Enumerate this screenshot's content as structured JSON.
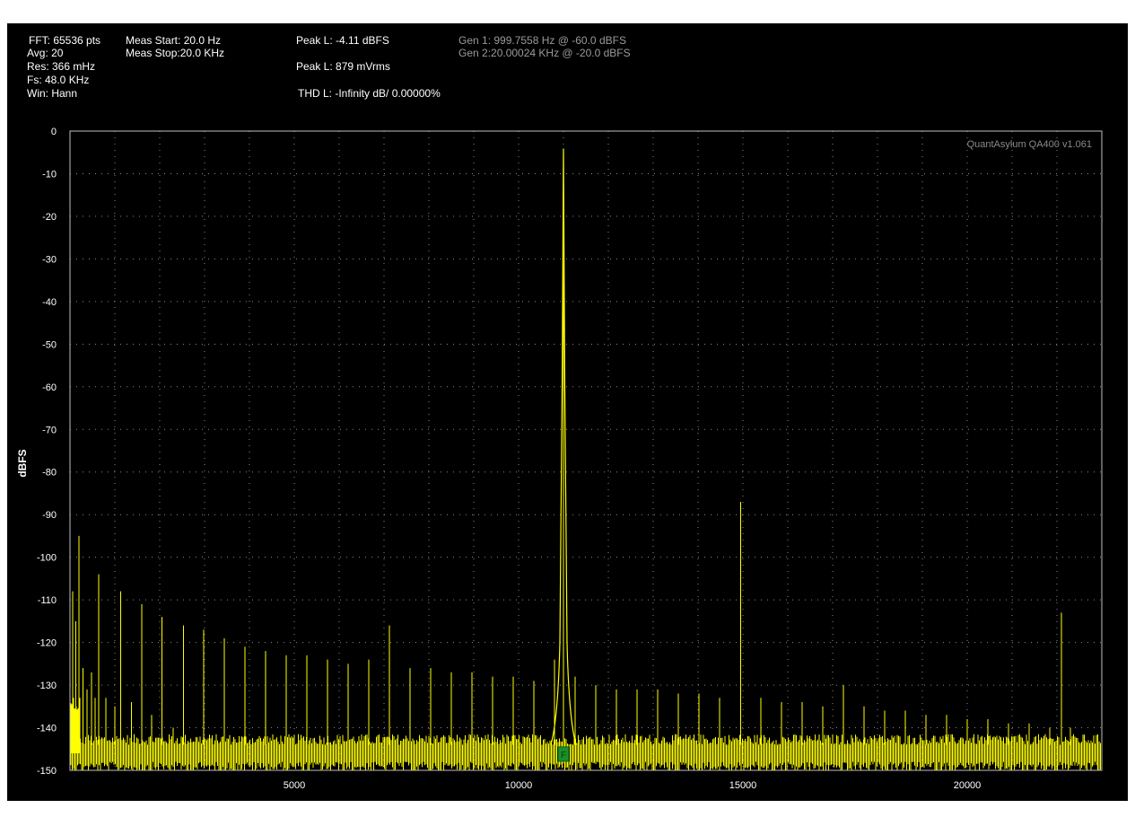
{
  "header": {
    "col1": [
      "FFT: 65536 pts",
      "Avg: 20",
      "Res: 366 mHz",
      "Fs: 48.0 KHz",
      "Win: Hann"
    ],
    "col2": [
      "Meas Start: 20.0 Hz",
      "Meas Stop:20.0 KHz"
    ],
    "peak_db": "Peak L: -4.11 dBFS",
    "peak_v": "Peak L: 879 mVrms",
    "thd": "THD L: -Infinity dB/ 0.00000%",
    "gen1": "Gen 1: 999.7558 Hz @ -60.0  dBFS",
    "gen2": "Gen 2:20.00024 KHz @ -20.0  dBFS"
  },
  "colors": {
    "background": "#000000",
    "trace": "#ffff00",
    "grid": "#8a8a8a",
    "marker": "#1a8f2a"
  },
  "chart_data": {
    "type": "line",
    "title": "",
    "brand_label": "QuantAsylum QA400 v1.061",
    "xlabel": "",
    "ylabel": "dBFS",
    "xlim": [
      0,
      23000
    ],
    "ylim": [
      -150,
      0
    ],
    "x_ticks": [
      5000,
      10000,
      15000,
      20000
    ],
    "x_tick_labels": [
      "5000",
      "10000",
      "15000",
      "20000"
    ],
    "y_ticks": [
      0,
      -10,
      -20,
      -30,
      -40,
      -50,
      -60,
      -70,
      -80,
      -90,
      -100,
      -110,
      -120,
      -130,
      -140,
      -150
    ],
    "y_tick_labels": [
      "0",
      "-10",
      "-20",
      "-30",
      "-40",
      "-50",
      "-60",
      "-70",
      "-80",
      "-90",
      "-100",
      "-110",
      "-120",
      "-130",
      "-140",
      "-150"
    ],
    "grid": true,
    "noise_floor_db": -146,
    "main_peak": {
      "x": 11000,
      "y": -4.1
    },
    "marker": {
      "x": 11000,
      "label": "F"
    },
    "series": [
      {
        "values": [
          {
            "x": 60,
            "y": -108
          },
          {
            "x": 130,
            "y": -115
          },
          {
            "x": 200,
            "y": -95
          },
          {
            "x": 290,
            "y": -126
          },
          {
            "x": 380,
            "y": -131
          },
          {
            "x": 480,
            "y": -127
          },
          {
            "x": 560,
            "y": -133
          },
          {
            "x": 640,
            "y": -104
          },
          {
            "x": 800,
            "y": -133
          },
          {
            "x": 1000,
            "y": -135
          },
          {
            "x": 1130,
            "y": -108
          },
          {
            "x": 1370,
            "y": -134
          },
          {
            "x": 1600,
            "y": -111
          },
          {
            "x": 1820,
            "y": -137
          },
          {
            "x": 2050,
            "y": -114
          },
          {
            "x": 2300,
            "y": -140
          },
          {
            "x": 2530,
            "y": -116
          },
          {
            "x": 2980,
            "y": -117
          },
          {
            "x": 3440,
            "y": -119
          },
          {
            "x": 3900,
            "y": -121
          },
          {
            "x": 4360,
            "y": -122
          },
          {
            "x": 4820,
            "y": -123
          },
          {
            "x": 5280,
            "y": -123
          },
          {
            "x": 5740,
            "y": -124
          },
          {
            "x": 6200,
            "y": -125
          },
          {
            "x": 6660,
            "y": -124
          },
          {
            "x": 7120,
            "y": -116
          },
          {
            "x": 7580,
            "y": -126
          },
          {
            "x": 8040,
            "y": -126
          },
          {
            "x": 8500,
            "y": -127
          },
          {
            "x": 8960,
            "y": -127
          },
          {
            "x": 9420,
            "y": -128
          },
          {
            "x": 9880,
            "y": -128
          },
          {
            "x": 10340,
            "y": -129
          },
          {
            "x": 10800,
            "y": -124
          },
          {
            "x": 11000,
            "y": -4.1
          },
          {
            "x": 11260,
            "y": -128
          },
          {
            "x": 11720,
            "y": -130
          },
          {
            "x": 12180,
            "y": -131
          },
          {
            "x": 12640,
            "y": -131
          },
          {
            "x": 13100,
            "y": -131
          },
          {
            "x": 13560,
            "y": -132
          },
          {
            "x": 14020,
            "y": -132
          },
          {
            "x": 14480,
            "y": -133
          },
          {
            "x": 14950,
            "y": -87
          },
          {
            "x": 15400,
            "y": -133
          },
          {
            "x": 15860,
            "y": -134
          },
          {
            "x": 16320,
            "y": -134
          },
          {
            "x": 16780,
            "y": -135
          },
          {
            "x": 17240,
            "y": -130
          },
          {
            "x": 17700,
            "y": -135
          },
          {
            "x": 18160,
            "y": -136
          },
          {
            "x": 18620,
            "y": -136
          },
          {
            "x": 19080,
            "y": -137
          },
          {
            "x": 19540,
            "y": -137
          },
          {
            "x": 20000,
            "y": -138
          },
          {
            "x": 20460,
            "y": -138
          },
          {
            "x": 20920,
            "y": -139
          },
          {
            "x": 21380,
            "y": -139
          },
          {
            "x": 21840,
            "y": -140
          },
          {
            "x": 22100,
            "y": -113
          },
          {
            "x": 22300,
            "y": -140
          }
        ]
      }
    ]
  }
}
